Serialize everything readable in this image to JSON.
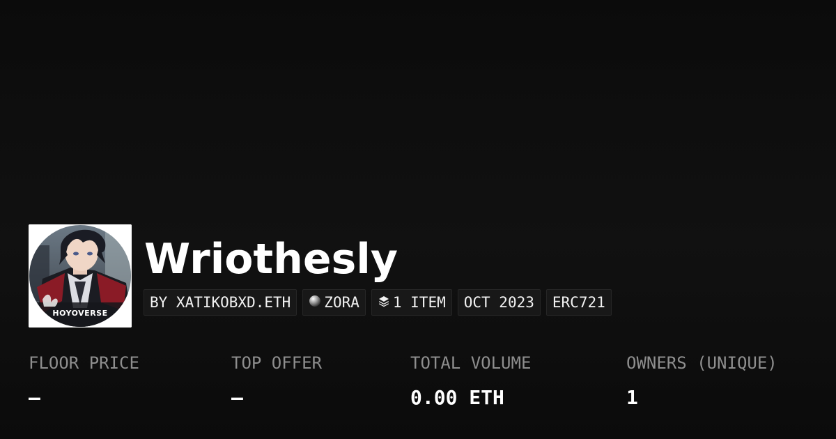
{
  "collection": {
    "name": "Wriothesly",
    "avatar_caption": "HOYOVERSE",
    "avatar_icon": "character-portrait-image"
  },
  "tags": [
    {
      "label": "BY XATIKOBXD.ETH",
      "icon": ""
    },
    {
      "label": "ZORA",
      "icon": "zora-orb-icon"
    },
    {
      "label": "1 ITEM",
      "icon": "layers-icon"
    },
    {
      "label": "OCT 2023",
      "icon": ""
    },
    {
      "label": "ERC721",
      "icon": ""
    }
  ],
  "stats": [
    {
      "label": "FLOOR PRICE",
      "value": "—"
    },
    {
      "label": "TOP OFFER",
      "value": "—"
    },
    {
      "label": "TOTAL VOLUME",
      "value": "0.00 ETH"
    },
    {
      "label": "OWNERS (UNIQUE)",
      "value": "1"
    }
  ],
  "colors": {
    "background": "#0a0a0a",
    "tag_background": "#181818",
    "label_text": "#8e8e8e",
    "value_text": "#ffffff"
  }
}
